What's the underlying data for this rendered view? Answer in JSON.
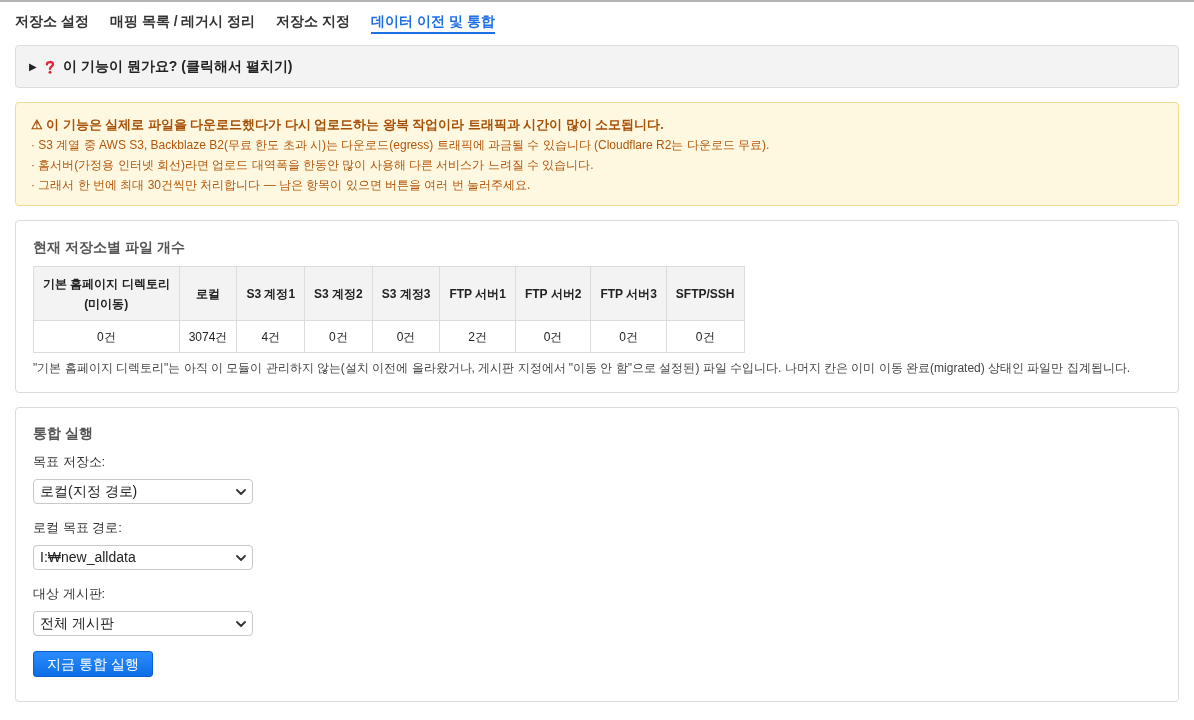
{
  "tabs": [
    {
      "label": "저장소 설정",
      "selected": false
    },
    {
      "label": "매핑 목록 / 레거시 정리",
      "selected": false
    },
    {
      "label": "저장소 지정",
      "selected": false
    },
    {
      "label": "데이터 이전 및 통합",
      "selected": true
    }
  ],
  "help_toggle": {
    "marker": "▶",
    "label": "이 기능이 뭔가요? (클릭해서 펼치기)",
    "expanded": false
  },
  "warning": {
    "title": "⚠ 이 기능은 실제로 파일을 다운로드했다가 다시 업로드하는 왕복 작업이라 트래픽과 시간이 많이 소모됩니다.",
    "lines": [
      "· S3 계열 중 AWS S3, Backblaze B2(무료 한도 초과 시)는 다운로드(egress) 트래픽에 과금될 수 있습니다 (Cloudflare R2는 다운로드 무료).",
      "· 홈서버(가정용 인터넷 회선)라면 업로드 대역폭을 한동안 많이 사용해 다른 서비스가 느려질 수 있습니다.",
      "· 그래서 한 번에 최대 30건씩만 처리합니다 — 남은 항목이 있으면 버튼을 여러 번 눌러주세요."
    ]
  },
  "file_counts": {
    "title": "현재 저장소별 파일 개수",
    "table": {
      "columns": [
        "기본 홈페이지 디렉토리\n(미이동)",
        "로컬",
        "S3 계정1",
        "S3 계정2",
        "S3 계정3",
        "FTP 서버1",
        "FTP 서버2",
        "FTP 서버3",
        "SFTP/SSH"
      ],
      "rows": [
        [
          "0건",
          "3074건",
          "4건",
          "0건",
          "0건",
          "2건",
          "0건",
          "0건",
          "0건"
        ]
      ]
    },
    "note": "\"기본 홈페이지 디렉토리\"는 아직 이 모듈이 관리하지 않는(설치 이전에 올라왔거나, 게시판 지정에서 \"이동 안 함\"으로 설정된) 파일 수입니다. 나머지 칸은 이미 이동 완료(migrated) 상태인 파일만 집계됩니다."
  },
  "run": {
    "title": "통합 실행",
    "fields": [
      {
        "label": "목표 저장소:",
        "value": "로컬(지정 경로)"
      },
      {
        "label": "로컬 목표 경로:",
        "value": "I:₩new_alldata"
      },
      {
        "label": "대상 게시판:",
        "value": "전체 게시판"
      }
    ],
    "button": "지금 통합 실행"
  }
}
